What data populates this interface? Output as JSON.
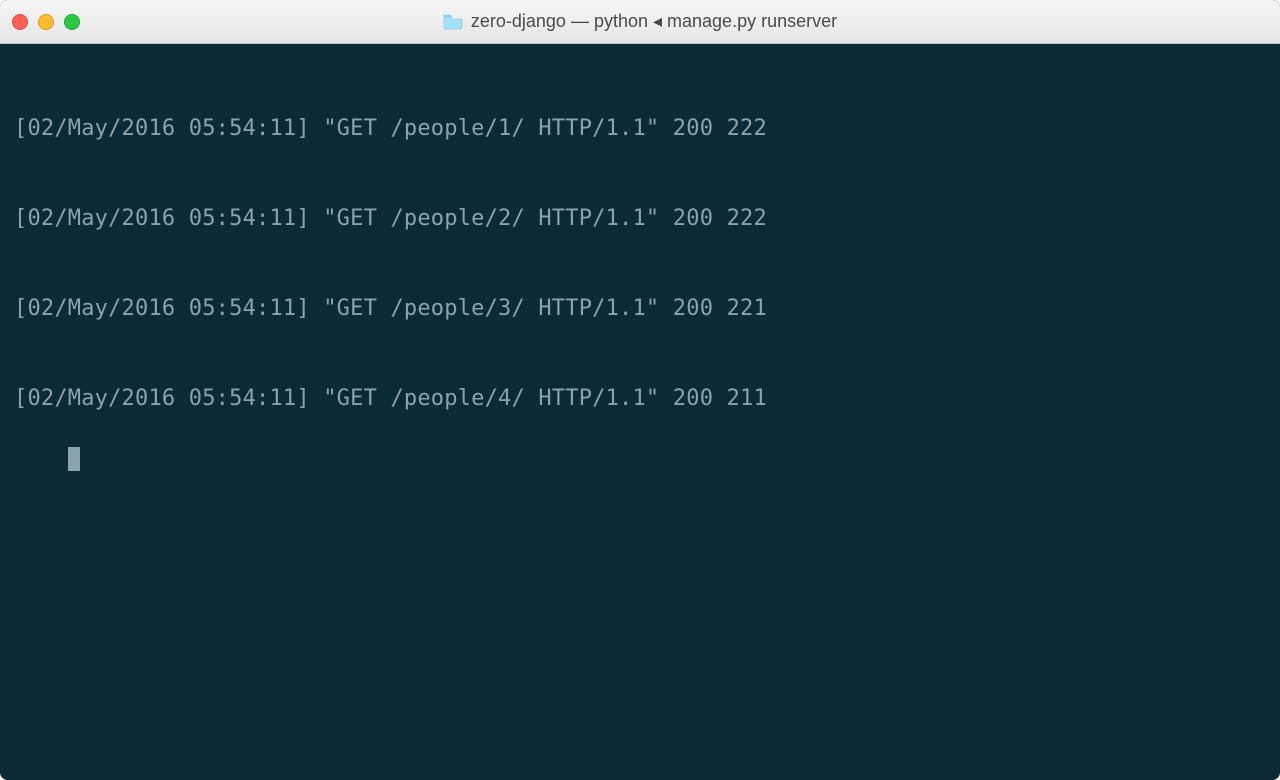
{
  "titlebar": {
    "title": "zero-django — python ◂ manage.py runserver"
  },
  "terminal": {
    "lines": [
      "[02/May/2016 05:54:11] \"GET /people/1/ HTTP/1.1\" 200 222",
      "[02/May/2016 05:54:11] \"GET /people/2/ HTTP/1.1\" 200 222",
      "[02/May/2016 05:54:11] \"GET /people/3/ HTTP/1.1\" 200 221",
      "[02/May/2016 05:54:11] \"GET /people/4/ HTTP/1.1\" 200 211"
    ]
  }
}
